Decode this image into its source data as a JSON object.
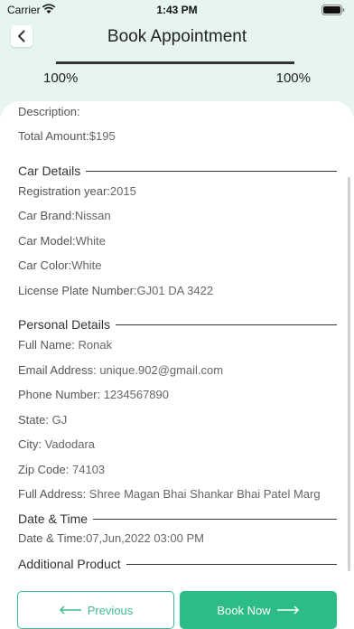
{
  "status_bar": {
    "carrier": "Carrier",
    "time": "1:43 PM"
  },
  "header": {
    "title": "Book Appointment"
  },
  "progress": {
    "left_label": "100%",
    "right_label": "100%",
    "value": 1.0
  },
  "summary": {
    "description_label": "Description:",
    "description_value": "",
    "total_label": "Total Amount:",
    "total_value": "$195"
  },
  "car_details": {
    "title": "Car Details",
    "fields": [
      {
        "label": "Registration year:",
        "value": "2015"
      },
      {
        "label": "Car Brand:",
        "value": "Nissan"
      },
      {
        "label": "Car Model:",
        "value": "White"
      },
      {
        "label": "Car Color:",
        "value": "White"
      },
      {
        "label": "License Plate Number:",
        "value": "GJ01 DA 3422"
      }
    ]
  },
  "personal_details": {
    "title": "Personal Details",
    "fields": [
      {
        "label": "Full Name:",
        "value": "Ronak"
      },
      {
        "label": "Email Address:",
        "value": "unique.902@gmail.com"
      },
      {
        "label": "Phone Number:",
        "value": "1234567890"
      },
      {
        "label": "State:",
        "value": "GJ"
      },
      {
        "label": "City:",
        "value": "Vadodara"
      },
      {
        "label": "Zip Code:",
        "value": "74103"
      },
      {
        "label": "Full Address:",
        "value": "Shree Magan Bhai Shankar Bhai Patel Marg"
      }
    ]
  },
  "date_time": {
    "title": "Date & Time",
    "label": "Date & Time:",
    "value": "07,Jun,2022 03:00 PM"
  },
  "additional_product": {
    "title": "Additional Product"
  },
  "buttons": {
    "previous": "Previous",
    "book_now": "Book Now"
  },
  "colors": {
    "accent": "#2dbb88",
    "background": "#e6f6ef"
  }
}
